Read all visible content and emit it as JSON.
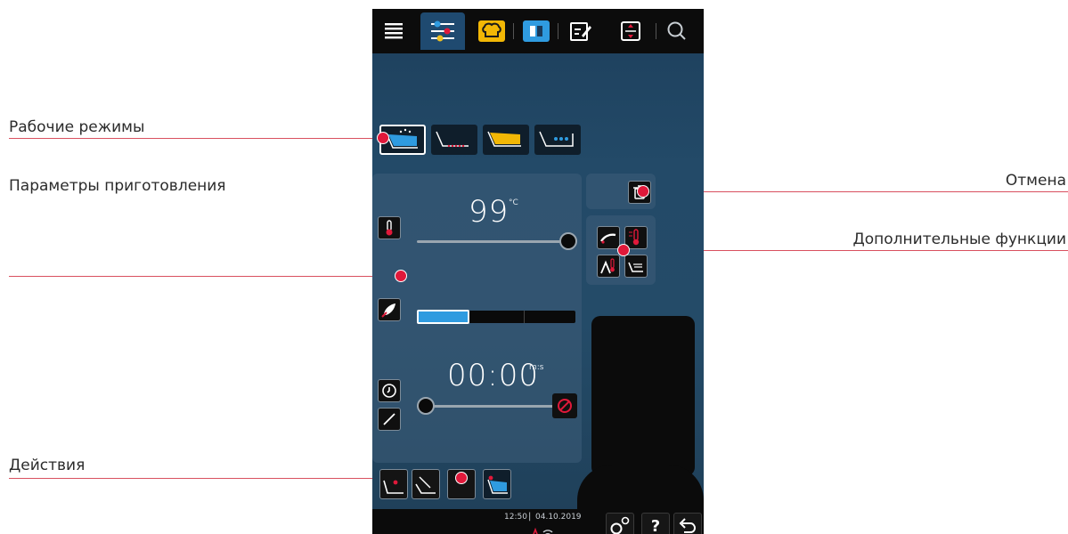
{
  "callouts": {
    "operating_modes": "Рабочие режимы",
    "cooking_parameters": "Параметры приготовления",
    "cancel": "Отмена",
    "additional_functions": "Дополнительные функции",
    "actions": "Действия"
  },
  "screen": {
    "temperature": {
      "value": "99",
      "unit": "°C",
      "level": 1.0
    },
    "humidity": {
      "level": 0.33
    },
    "timer": {
      "value": "00:00",
      "unit": "m:s",
      "level": 0.0
    },
    "status": {
      "time": "12:50",
      "date": "04.10.2019"
    },
    "help_label": "?",
    "accent_color": "#e0193a",
    "highlight_color": "#2f9be0"
  }
}
